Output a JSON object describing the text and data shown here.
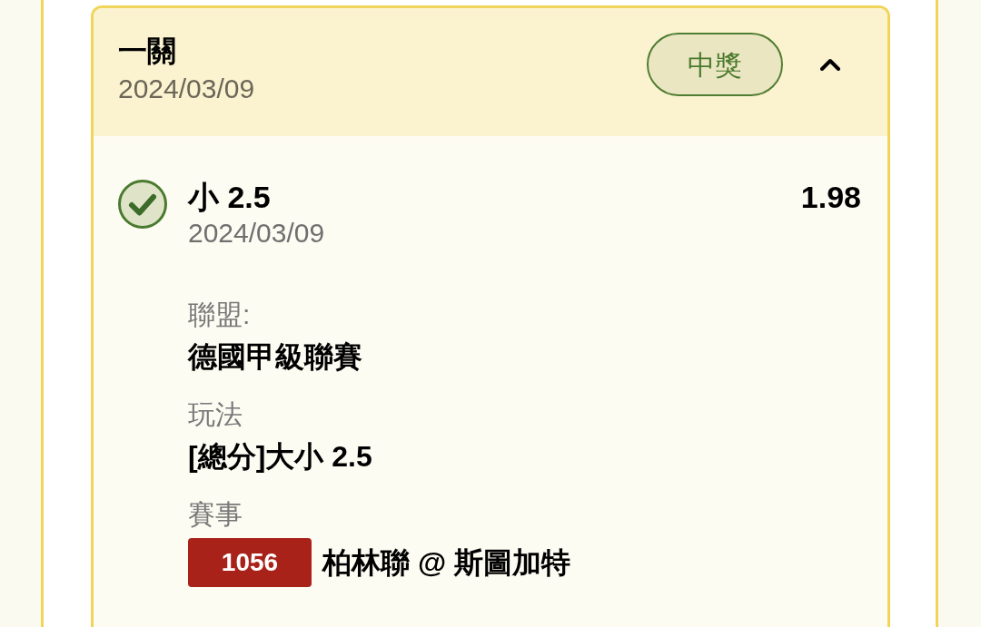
{
  "card": {
    "title": "一關",
    "date": "2024/03/09",
    "status": "中獎",
    "expanded": true,
    "bet": {
      "won": true,
      "selection": "小 2.5",
      "odds": "1.98",
      "date": "2024/03/09",
      "details": [
        {
          "kind": "text",
          "label": "聯盟:",
          "value": "德國甲級聯賽"
        },
        {
          "kind": "text",
          "label": "玩法",
          "value": "[總分]大小 2.5"
        },
        {
          "kind": "match",
          "label": "賽事",
          "match_number": "1056",
          "value": "柏林聯 @ 斯圖加特"
        }
      ]
    }
  }
}
